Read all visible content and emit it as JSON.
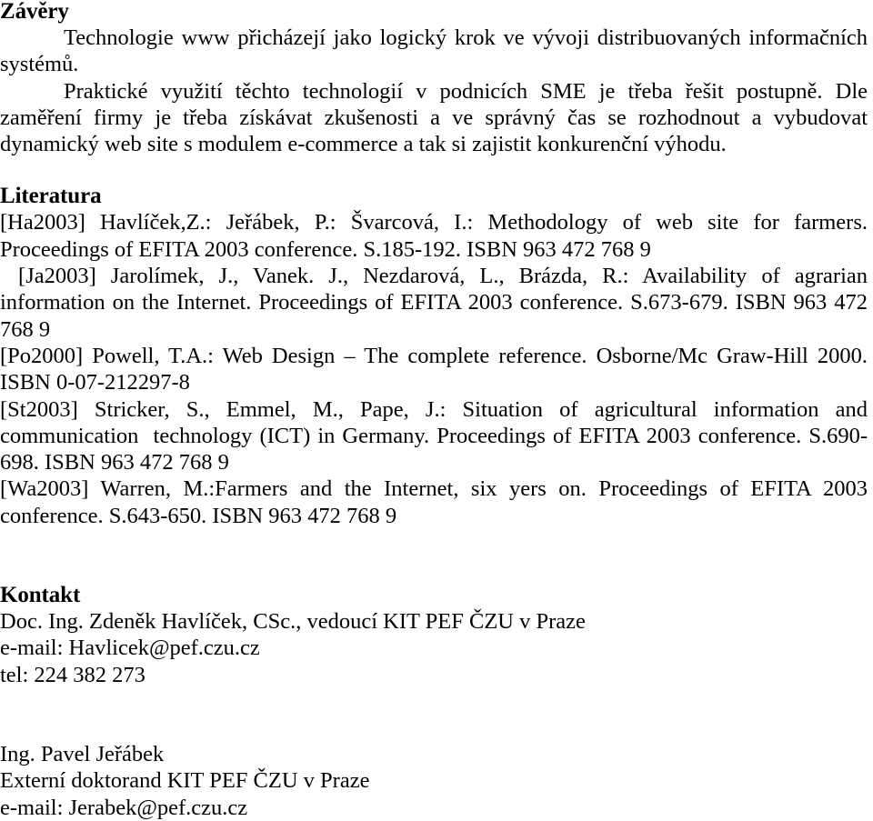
{
  "document": {
    "language": "cs",
    "text_color": "#000000",
    "background_color": "#ffffff"
  },
  "conclusions": {
    "heading": "Závěry",
    "paragraphs": [
      "Technologie www přicházejí jako logický krok ve vývoji distribuovaných informačních systémů.",
      "Praktické využití těchto technologií v podnicích SME je třeba řešit postupně. Dle zaměření firmy je třeba získávat zkušenosti a ve správný čas se rozhodnout a vybudovat dynamický web site s modulem e-commerce a tak si zajistit konkurenční výhodu."
    ]
  },
  "literature": {
    "heading": "Literatura",
    "entries": [
      {
        "key": "[Ha2003]",
        "text": "[Ha2003] Havlíček,Z.: Jeřábek, P.: Švarcová, I.: Methodology of web site for farmers. Proceedings of EFITA 2003 conference. S.185-192. ISBN 963 472 768 9"
      },
      {
        "key": "[Ja2003]",
        "text": " [Ja2003] Jarolímek, J., Vanek. J., Nezdarová, L., Brázda, R.: Availability of agrarian information on the Internet. Proceedings of EFITA 2003 conference. S.673-679. ISBN 963 472 768 9"
      },
      {
        "key": "[Po2000]",
        "text": "[Po2000] Powell, T.A.: Web Design – The complete reference. Osborne/Mc Graw-Hill 2000. ISBN 0-07-212297-8"
      },
      {
        "key": "[St2003]",
        "text": "[St2003] Stricker, S., Emmel, M., Pape, J.: Situation of agricultural information and communication  technology (ICT) in Germany. Proceedings of EFITA 2003 conference. S.690-698. ISBN 963 472 768 9"
      },
      {
        "key": "[Wa2003]",
        "text": "[Wa2003] Warren, M.:Farmers and the Internet, six yers on. Proceedings of EFITA 2003 conference. S.643-650. ISBN 963 472 768 9"
      }
    ]
  },
  "contact": {
    "heading": "Kontakt",
    "person_one": {
      "name_line": "Doc. Ing. Zdeněk Havlíček, CSc., vedoucí KIT PEF ČZU v Praze",
      "email_line": "e-mail: Havlicek@pef.czu.cz",
      "phone_line": "tel: 224 382 273"
    },
    "person_two": {
      "name_line": "Ing. Pavel Jeřábek",
      "role_line": "Externí doktorand KIT PEF ČZU v Praze",
      "email_line": "e-mail: Jerabek@pef.czu.cz"
    }
  }
}
